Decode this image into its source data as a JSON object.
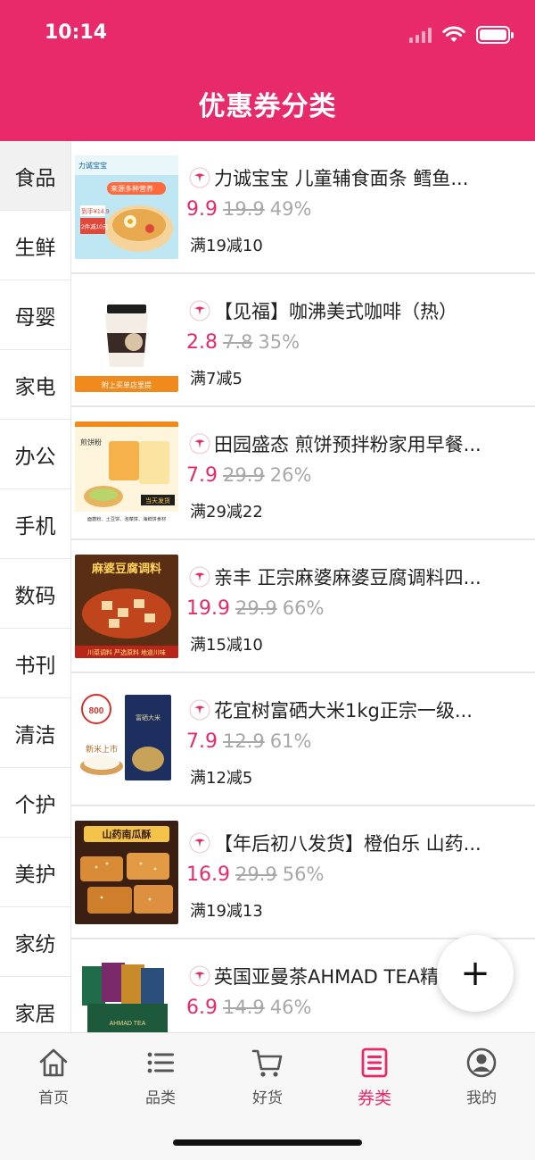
{
  "status_bar": {
    "time": "10:14"
  },
  "header": {
    "title": "优惠券分类"
  },
  "colors": {
    "brand": "#e8296a",
    "muted": "#a8a8a8"
  },
  "sidebar": {
    "active_index": 0,
    "items": [
      {
        "label": "食品"
      },
      {
        "label": "生鲜"
      },
      {
        "label": "母婴"
      },
      {
        "label": "家电"
      },
      {
        "label": "办公"
      },
      {
        "label": "手机"
      },
      {
        "label": "数码"
      },
      {
        "label": "书刊"
      },
      {
        "label": "清洁"
      },
      {
        "label": "个护"
      },
      {
        "label": "美护"
      },
      {
        "label": "家纺"
      },
      {
        "label": "家居"
      }
    ]
  },
  "products": [
    {
      "title": "力诚宝宝 儿童辅食面条 鳕鱼...",
      "price": "9.9",
      "original_price": "19.9",
      "discount": "49%",
      "coupon": "满19减10",
      "image": {
        "badge": "力诚宝宝",
        "headline": "来源多种营养",
        "tag1": "到手¥14.9",
        "tag2": "2件减10元"
      }
    },
    {
      "title": "【见福】咖沸美式咖啡（热）",
      "price": "2.8",
      "original_price": "7.8",
      "discount": "35%",
      "coupon": "满7减5",
      "image": {
        "banner": "附上买单店里提"
      }
    },
    {
      "title": "田园盛态 煎饼预拌粉家用早餐...",
      "price": "7.9",
      "original_price": "29.9",
      "discount": "26%",
      "coupon": "满29减22",
      "image": {
        "label1": "煎饼粉",
        "label2": "当天发货",
        "footer": "面筋粉、土豆饼、泡菜饼、海鲜饼食材"
      }
    },
    {
      "title": "亲丰 正宗麻婆麻婆豆腐调料四...",
      "price": "19.9",
      "original_price": "29.9",
      "discount": "66%",
      "coupon": "满15减10",
      "image": {
        "headline": "麻婆豆腐调料",
        "footer": "川菜调料 严选原料 地道川味"
      }
    },
    {
      "title": "花宜树富硒大米1kg正宗一级...",
      "price": "7.9",
      "original_price": "12.9",
      "discount": "61%",
      "coupon": "满12减5",
      "image": {
        "badge_value": "800",
        "box_text": "富硒大米",
        "footer": "新米上市"
      }
    },
    {
      "title": "【年后初八发货】橙伯乐 山药...",
      "price": "16.9",
      "original_price": "29.9",
      "discount": "56%",
      "coupon": "满19减13",
      "image": {
        "headline": "山药南瓜酥"
      }
    },
    {
      "title": "英国亚曼茶AHMAD TEA精...",
      "price": "6.9",
      "original_price": "14.9",
      "discount": "46%",
      "coupon": "",
      "image": {
        "box_text": "AHMAD TEA"
      }
    }
  ],
  "fab": {
    "label": "+"
  },
  "tabbar": {
    "active_index": 3,
    "items": [
      {
        "label": "首页",
        "icon": "home-icon"
      },
      {
        "label": "品类",
        "icon": "list-icon"
      },
      {
        "label": "好货",
        "icon": "cart-icon"
      },
      {
        "label": "券类",
        "icon": "coupon-icon"
      },
      {
        "label": "我的",
        "icon": "profile-icon"
      }
    ]
  }
}
